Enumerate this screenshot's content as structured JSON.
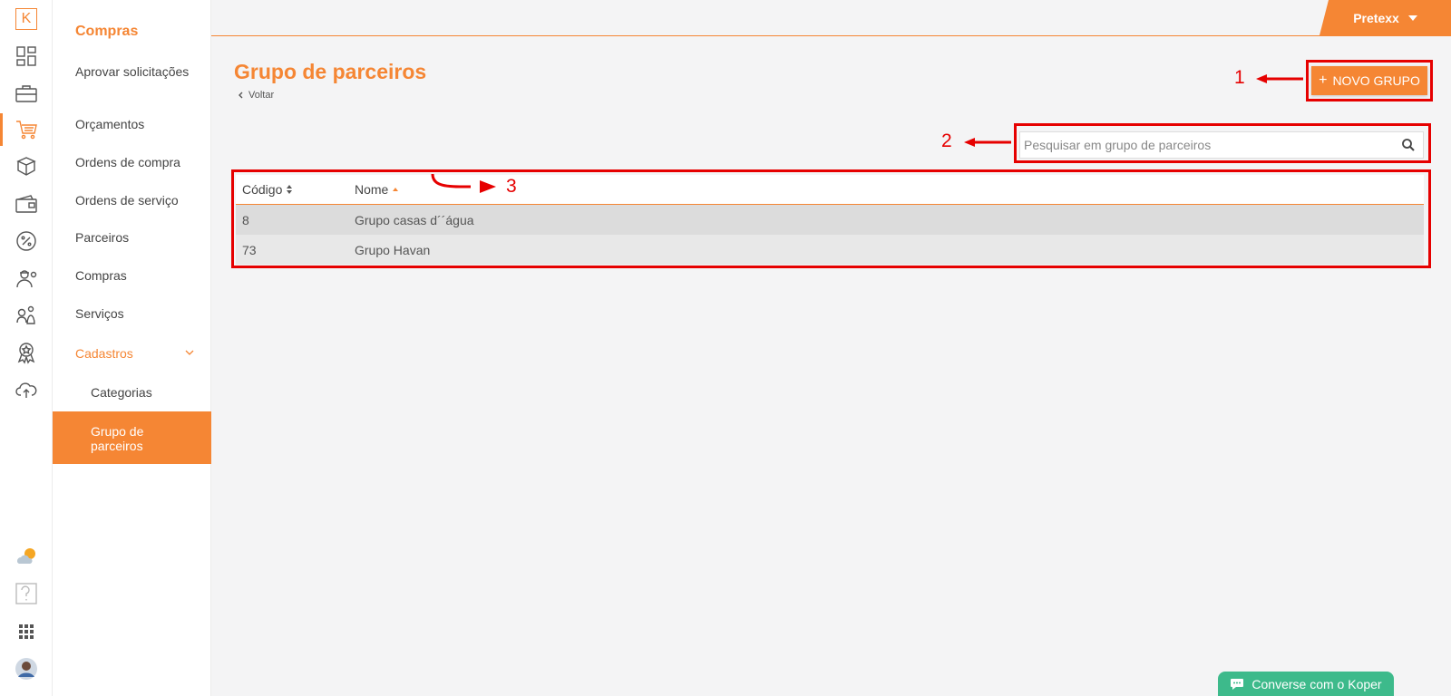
{
  "rail": {
    "logo": "K"
  },
  "submenu": {
    "section_title": "Compras",
    "items": [
      {
        "label": "Aprovar solicitações"
      },
      {
        "label": "Orçamentos"
      },
      {
        "label": "Ordens de compra"
      },
      {
        "label": "Ordens de serviço"
      },
      {
        "label": "Parceiros"
      },
      {
        "label": "Compras"
      },
      {
        "label": "Serviços"
      }
    ],
    "cadastros": "Cadastros",
    "children": [
      {
        "label": "Categorias"
      },
      {
        "label": "Grupo de parceiros"
      }
    ]
  },
  "topbar": {
    "user": "Pretexx"
  },
  "page": {
    "title": "Grupo de parceiros",
    "back": "Voltar",
    "new_button": "NOVO GRUPO",
    "search_placeholder": "Pesquisar em grupo de parceiros"
  },
  "table": {
    "headers": {
      "code": "Código",
      "name": "Nome"
    },
    "rows": [
      {
        "code": "8",
        "name": "Grupo casas d´´água"
      },
      {
        "code": "73",
        "name": "Grupo Havan"
      }
    ]
  },
  "annotations": {
    "n1": "1",
    "n2": "2",
    "n3": "3"
  },
  "chat": {
    "label": "Converse com o Koper"
  },
  "colors": {
    "accent": "#f58634",
    "annotation": "#e60000",
    "chat": "#3dba8b"
  }
}
